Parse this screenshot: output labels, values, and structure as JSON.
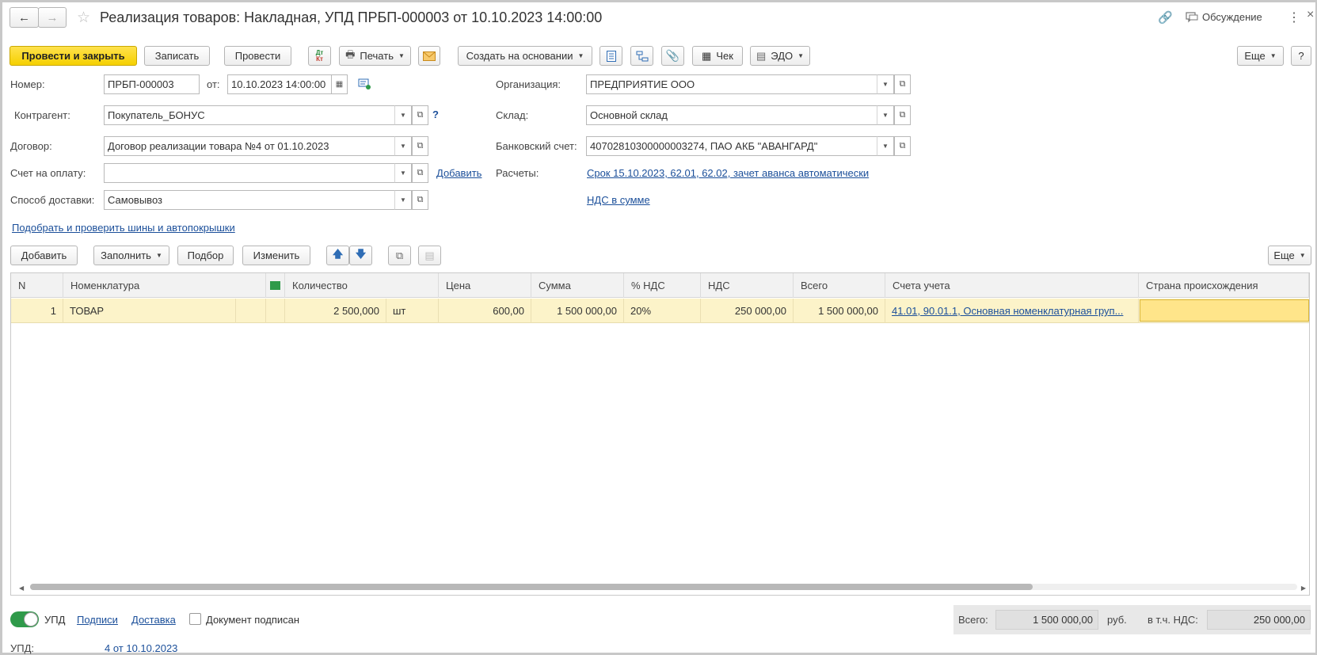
{
  "window": {
    "title": "Реализация товаров: Накладная, УПД ПРБП-000003 от 10.10.2023 14:00:00",
    "discussion_label": "Обсуждение"
  },
  "toolbar": {
    "post_close": "Провести и закрыть",
    "save": "Записать",
    "post": "Провести",
    "dtkt_top": "Дт",
    "dtkt_bottom": "Кт",
    "print": "Печать",
    "create_based": "Создать на основании",
    "check": "Чек",
    "edo": "ЭДО",
    "more": "Еще",
    "help": "?"
  },
  "form": {
    "number_label": "Номер:",
    "number_value": "ПРБП-000003",
    "date_label": "от:",
    "date_value": "10.10.2023 14:00:00",
    "org_label": "Организация:",
    "org_value": "ПРЕДПРИЯТИЕ ООО",
    "contractor_label": "Контрагент:",
    "contractor_value": "Покупатель_БОНУС",
    "contractor_help": "?",
    "warehouse_label": "Склад:",
    "warehouse_value": "Основной склад",
    "contract_label": "Договор:",
    "contract_value": "Договор реализации товара №4 от 01.10.2023",
    "bank_label": "Банковский счет:",
    "bank_value": "40702810300000003274, ПАО АКБ \"АВАНГАРД\"",
    "invoice_label": "Счет на оплату:",
    "invoice_value": "",
    "invoice_add": "Добавить",
    "settlements_label": "Расчеты:",
    "settlements_link": "Срок 15.10.2023, 62.01, 62.02, зачет аванса автоматически",
    "delivery_label": "Способ доставки:",
    "delivery_value": "Самовывоз",
    "vat_link": "НДС в сумме",
    "tires_link": "Подобрать и проверить шины и автопокрышки"
  },
  "table_toolbar": {
    "add": "Добавить",
    "fill": "Заполнить",
    "pick": "Подбор",
    "change": "Изменить",
    "more": "Еще"
  },
  "table": {
    "columns": [
      "N",
      "Номенклатура",
      "Количество",
      "Цена",
      "Сумма",
      "% НДС",
      "НДС",
      "Всего",
      "Счета учета",
      "Страна происхождения"
    ],
    "rows": [
      {
        "n": "1",
        "item": "ТОВАР",
        "qty": "2 500,000",
        "unit": "шт",
        "price": "600,00",
        "sum": "1 500 000,00",
        "vat_rate": "20%",
        "vat": "250 000,00",
        "total": "1 500 000,00",
        "accounts": "41.01, 90.01.1, Основная номенклатурная груп...",
        "country": ""
      }
    ]
  },
  "footer": {
    "upd_label": "УПД",
    "signatures_link": "Подписи",
    "delivery_link": "Доставка",
    "signed_label": "Документ подписан",
    "upd_ref_label": "УПД:",
    "upd_ref_link": "4 от 10.10.2023",
    "total_label": "Всего:",
    "total_value": "1 500 000,00",
    "currency": "руб.",
    "vat_label": "в т.ч. НДС:",
    "vat_value": "250 000,00"
  },
  "colors": {
    "accent_yellow": "#f5d000",
    "row_highlight": "#fcf3c9",
    "link_blue": "#1b4f9a",
    "toggle_green": "#2f9a4a"
  }
}
